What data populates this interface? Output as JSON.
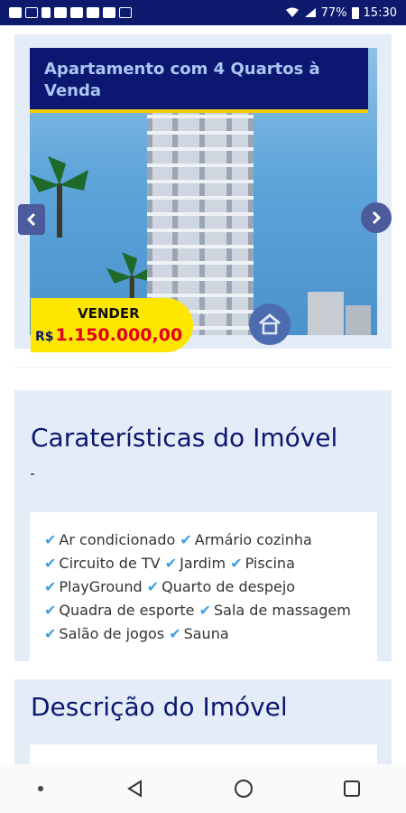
{
  "status_bar": {
    "battery_percent": "77%",
    "time": "15:30",
    "left_icons": [
      "facebook-icon",
      "mail-icon",
      "phone-icon",
      "youtube-icon",
      "youtube-icon",
      "youtube-icon",
      "youtube-icon",
      "calendar-icon"
    ]
  },
  "listing": {
    "title": "Apartamento com 4 Quartos à Venda",
    "badge_label": "VENDER",
    "currency": "R$",
    "price": "1.150.000,00",
    "dots": "..."
  },
  "features_section": {
    "heading": "Caraterísticas do Imóvel",
    "items": [
      "Ar condicionado",
      "Armário cozinha",
      "Circuito de TV",
      "Jardim",
      "Piscina",
      "PlayGround",
      "Quarto de despejo",
      "Quadra de esporte",
      "Sala de massagem",
      "Salão de jogos",
      "Sauna"
    ]
  },
  "description_section": {
    "heading": "Descrição do Imóvel"
  },
  "colors": {
    "status_bar": "#0d1a6e",
    "title_band": "#0b1770",
    "accent_yellow": "#ffe600",
    "price_red": "#e3001b",
    "check_blue": "#3ea0e2",
    "section_bg": "#e4edf7"
  }
}
